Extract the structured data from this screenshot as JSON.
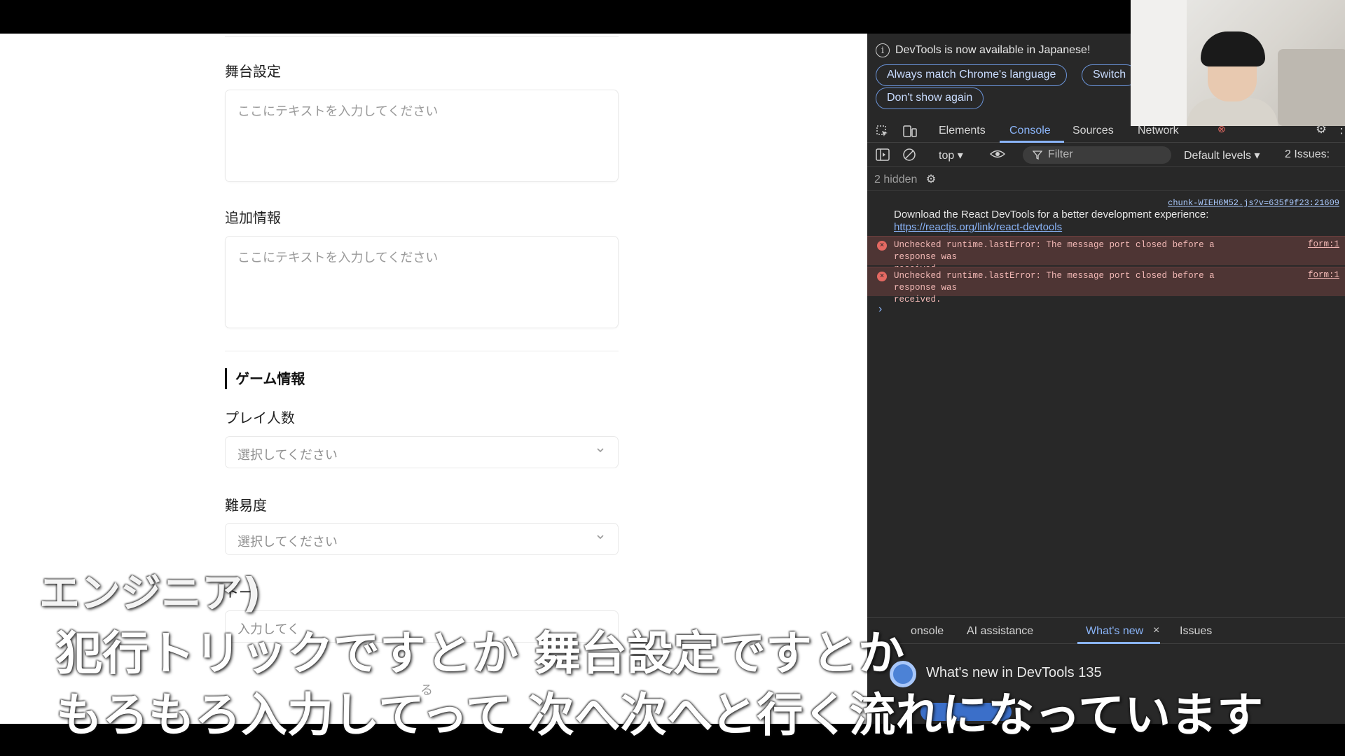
{
  "form": {
    "stage_setting_label": "舞台設定",
    "stage_setting_placeholder": "ここにテキストを入力してください",
    "additional_info_label": "追加情報",
    "additional_info_placeholder": "ここにテキストを入力してください",
    "game_info_heading": "ゲーム情報",
    "players_label": "プレイ人数",
    "players_placeholder": "選択してください",
    "difficulty_label": "難易度",
    "difficulty_placeholder": "選択してください",
    "partial_label": "トー/",
    "partial_input_placeholder": "入力してく",
    "partial_button": "る"
  },
  "devtools": {
    "info_banner": "DevTools is now available in Japanese!",
    "btn_match_language": "Always match Chrome's language",
    "btn_switch": "Switch",
    "btn_dont_show": "Don't show again",
    "tabs": [
      "Elements",
      "Console",
      "Sources",
      "Network"
    ],
    "active_tab": "Console",
    "context": "top ▾",
    "filter_placeholder": "Filter",
    "levels": "Default levels ▾",
    "issues": "2 Issues:",
    "hidden": "2 hidden",
    "source_link": "chunk-WIEH6M52.js?v=635f9f23:21609",
    "react_msg": "Download the React DevTools for a better development experience:",
    "react_link": "https://reactjs.org/link/react-devtools",
    "errors": [
      {
        "line1": "Unchecked runtime.lastError: The message port closed before a response was",
        "line2": "received.",
        "source": "form:1"
      },
      {
        "line1": "Unchecked runtime.lastError: The message port closed before a response was",
        "line2": "received.",
        "source": "form:1"
      }
    ],
    "prompt": "›",
    "drawer_tabs": [
      "onsole",
      "AI assistance",
      "What's new",
      "Issues"
    ],
    "drawer_active": "What's new",
    "whats_new_title": "What's new in DevTools 135"
  },
  "subtitles": {
    "speaker": "エンジニア)",
    "line1": "犯行トリックですとか 舞台設定ですとか",
    "line2": "もろもろ入力してって 次へ次へと行く流れになっています"
  },
  "colors": {
    "devtools_bg": "#282828",
    "accent_blue": "#8ab4f8",
    "error_bg": "#4e3534",
    "error_text": "#f2b8b5"
  }
}
